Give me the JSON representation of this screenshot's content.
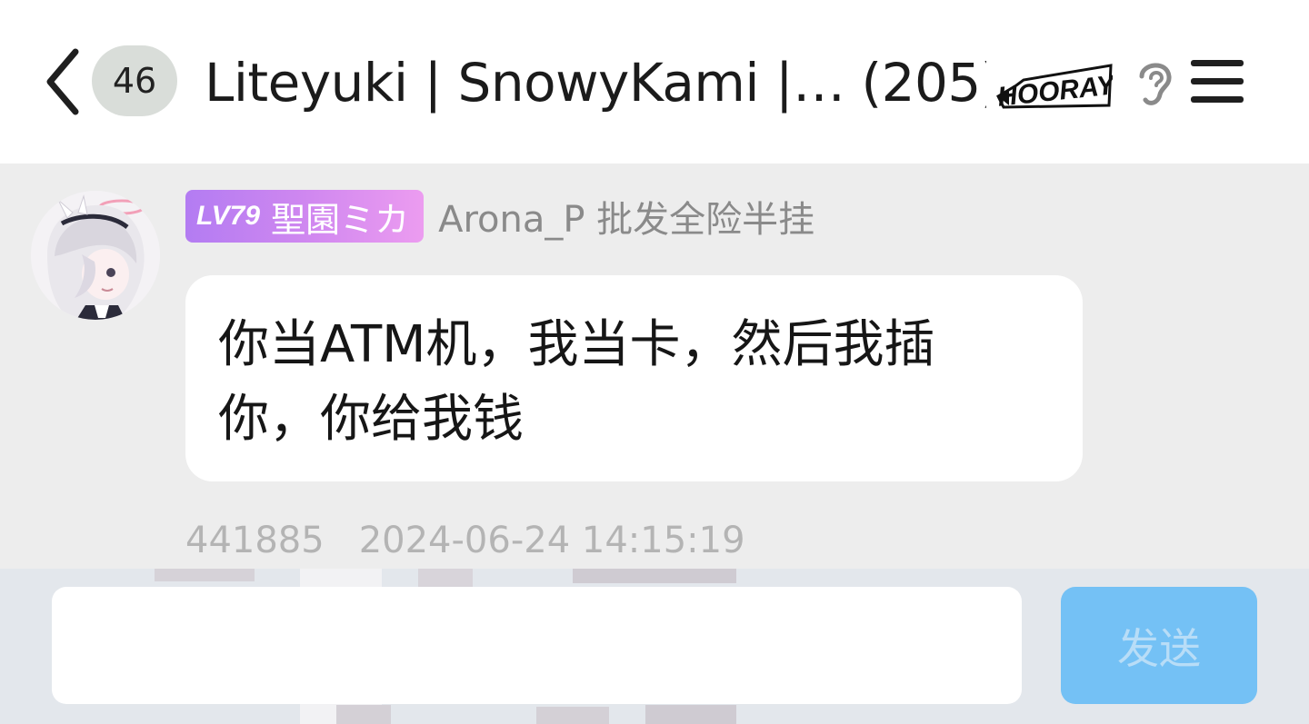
{
  "header": {
    "unread_count": "46",
    "title": "Liteyuki | SnowyKami |… (205)",
    "sticker_text": "HOORAY"
  },
  "message": {
    "level": "LV79",
    "level_title": "聖園ミカ",
    "sender_name": "Arona_P 批发全险半挂",
    "text": "你当ATM机，我当卡，然后我插你，你给我钱",
    "message_id": "441885",
    "timestamp": "2024-06-24 14:15:19"
  },
  "input": {
    "value": "",
    "send_label": "发送"
  },
  "colors": {
    "header_bg": "#ffffff",
    "chat_bg": "#ededed",
    "bubble_bg": "#ffffff",
    "level_badge_start": "#b37cf2",
    "level_badge_end": "#ec9cf0",
    "send_button": "#74c1f5",
    "meta_text": "#b4b4b4"
  },
  "icons": {
    "back": "chevron-left-icon",
    "listen": "ear-icon",
    "menu": "hamburger-menu-icon"
  }
}
